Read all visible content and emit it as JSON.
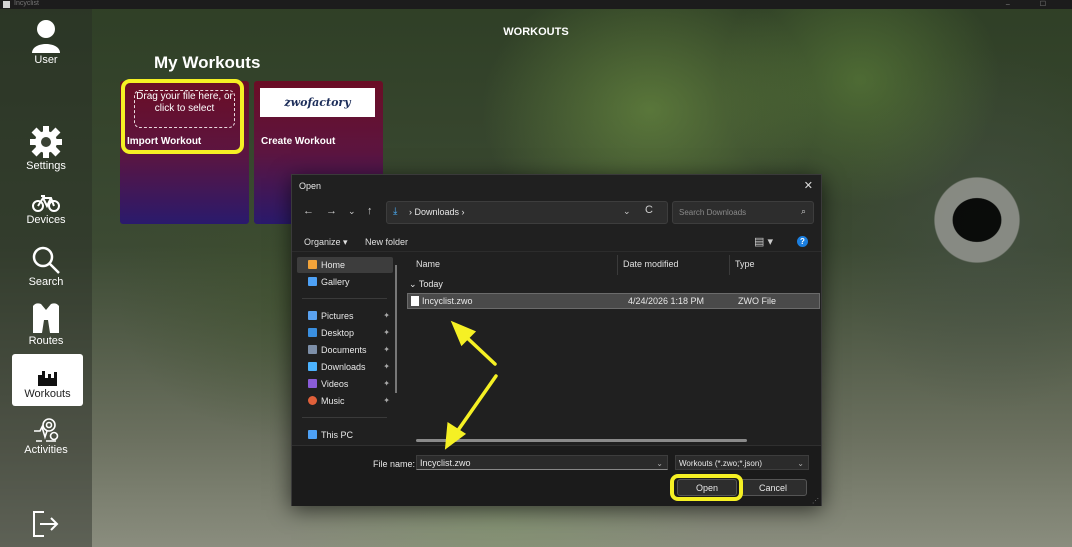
{
  "window": {
    "title": "Incyclist",
    "controls": "– ☐"
  },
  "page": {
    "heading": "WORKOUTS",
    "section_title": "My Workouts"
  },
  "sidebar": {
    "items": [
      {
        "label": "User",
        "icon": "user-icon"
      },
      {
        "label": "Settings",
        "icon": "gear-icon"
      },
      {
        "label": "Devices",
        "icon": "bicycle-icon"
      },
      {
        "label": "Search",
        "icon": "search-icon"
      },
      {
        "label": "Routes",
        "icon": "map-icon"
      },
      {
        "label": "Workouts",
        "icon": "workouts-icon",
        "active": true
      },
      {
        "label": "Activities",
        "icon": "activities-icon"
      }
    ],
    "logout_icon": "logout-icon"
  },
  "cards": {
    "import": {
      "dropzone_text": "Drag your file here, or click to select",
      "caption": "Import Workout"
    },
    "create": {
      "logo_text": "zwofactory",
      "caption": "Create Workout"
    }
  },
  "dialog": {
    "title": "Open",
    "close": "✕",
    "nav": {
      "back": "←",
      "forward": "→",
      "recent": "⌄",
      "up": "↑"
    },
    "address": {
      "path": "› Downloads ›",
      "refresh": "C",
      "dropdown": "⌄"
    },
    "search_placeholder": "Search Downloads",
    "toolbar": {
      "organize": "Organize ▾",
      "new_folder": "New folder",
      "help": "?"
    },
    "tree": [
      {
        "label": "Home",
        "color": "#f2a33a",
        "selected": true
      },
      {
        "label": "Gallery",
        "color": "#4ea1f5"
      },
      {
        "label": "Pictures",
        "color": "#5aa2f0",
        "pinned": true
      },
      {
        "label": "Desktop",
        "color": "#3a8fe0",
        "pinned": true
      },
      {
        "label": "Documents",
        "color": "#7d8fa8",
        "pinned": true
      },
      {
        "label": "Downloads",
        "color": "#4cb3ff",
        "pinned": true
      },
      {
        "label": "Videos",
        "color": "#8a5cd8",
        "pinned": true
      },
      {
        "label": "Music",
        "color": "#e0603a",
        "pinned": true
      },
      {
        "label": "This PC",
        "color": "#4ea1f5"
      }
    ],
    "columns": {
      "name": "Name",
      "date": "Date modified",
      "type": "Type"
    },
    "group": "Today",
    "files": [
      {
        "name": "Incyclist.zwo",
        "date": "4/24/2026 1:18 PM",
        "type": "ZWO File"
      }
    ],
    "file_name_label": "File name:",
    "file_name_value": "Incyclist.zwo",
    "filter": "Workouts (*.zwo;*.json)",
    "open_label": "Open",
    "cancel_label": "Cancel"
  },
  "colors": {
    "highlight": "#f5f024",
    "card_top": "#6b0d25",
    "card_bottom": "#2a1a6c"
  }
}
